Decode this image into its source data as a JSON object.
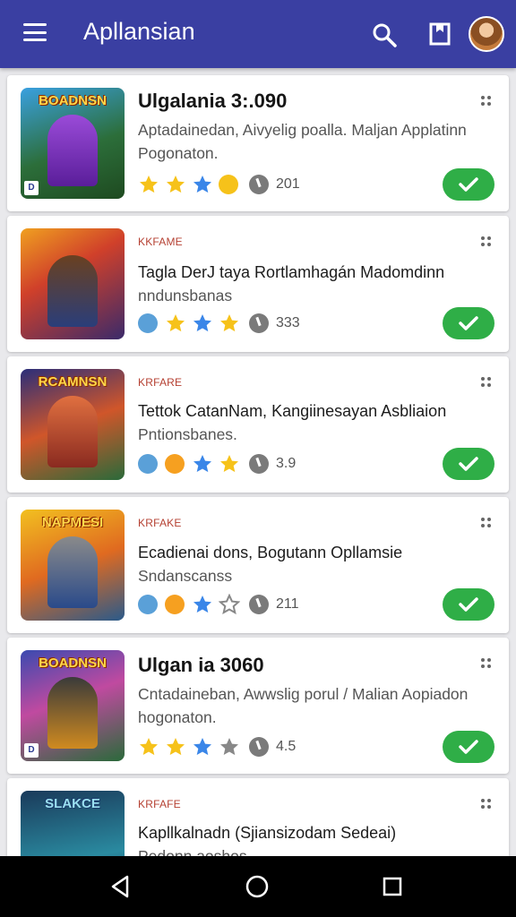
{
  "app": {
    "title": "Apllansian"
  },
  "colors": {
    "appbar": "#3a3fa2",
    "check": "#2fae47",
    "kicker": "#b54032",
    "star": "#f6c21a",
    "star_blue": "#3a86e8"
  },
  "icons": {
    "menu": "hamburger-icon",
    "search": "search-icon",
    "bookmark": "bookmark-icon",
    "more": "more-dots-icon",
    "check": "check-icon",
    "back": "back-icon",
    "home": "home-icon",
    "recents": "recents-icon"
  },
  "cards": [
    {
      "thumb_title": "BOADNSN",
      "badge": "D",
      "kicker": "",
      "title": "Ulgalania 3:.090",
      "desc": "Aptadainedan, Aivyelig poalla. Maljan Applatinn Pogonaton.",
      "count": "201"
    },
    {
      "thumb_title": "",
      "badge": "",
      "kicker": "KKFAME",
      "title": "Tagla DerJ taya Rortlamhagán Madomdinn",
      "desc": "nndunsbanas",
      "count": "333"
    },
    {
      "thumb_title": "RCAMNSN",
      "badge": "",
      "kicker": "KRFARE",
      "title": "Tettok CatanNam, Kangiinesayan Asbliaion",
      "desc": "Pntionsbanes.",
      "count": "3.9"
    },
    {
      "thumb_title": "NAPMESI",
      "badge": "",
      "kicker": "KRFAKE",
      "title": "Ecadienai dons, Bogutann Opllamsie",
      "desc": "Sndanscanss",
      "count": "211"
    },
    {
      "thumb_title": "BOADNSN",
      "badge": "D",
      "kicker": "",
      "title": "Ulgan ia 3060",
      "desc": "Cntadaineban, Awwslig porul / Malian Aopiadon hogonaton.",
      "count": "4.5"
    },
    {
      "thumb_title": "SLAKCE",
      "badge": "",
      "kicker": "KRFAFE",
      "title": "Kapllkalnadn (Sjiansizodam Sedeai)",
      "desc": "Pedonn aoshos",
      "count": ""
    }
  ]
}
